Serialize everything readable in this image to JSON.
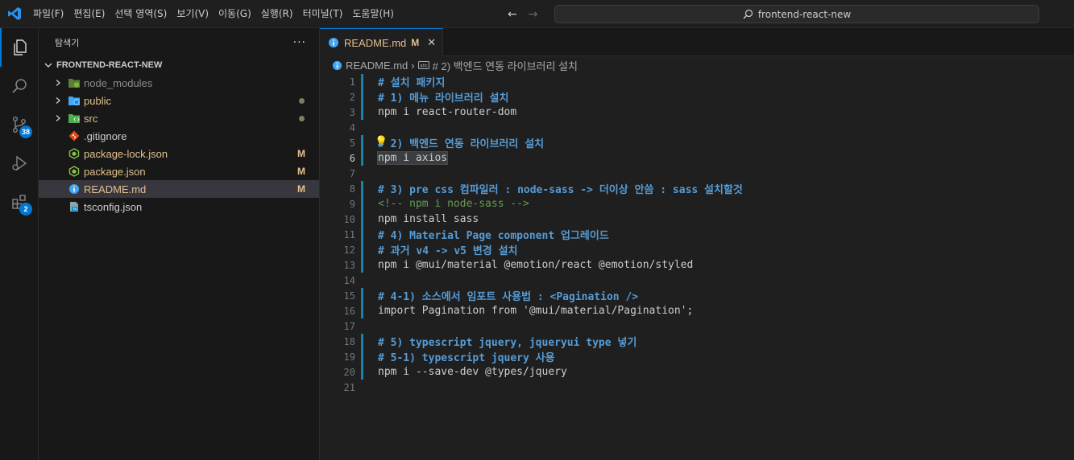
{
  "menu": [
    "파일(F)",
    "편집(E)",
    "선택 영역(S)",
    "보기(V)",
    "이동(G)",
    "실행(R)",
    "터미널(T)",
    "도움말(H)"
  ],
  "command_center": {
    "text": "frontend-react-new"
  },
  "activity": {
    "scm_badge": "38",
    "extensions_badge": "2"
  },
  "sidebar": {
    "title": "탐색기",
    "more": "···",
    "folder": "FRONTEND-REACT-NEW",
    "items": [
      {
        "name": "node_modules",
        "decoration": ""
      },
      {
        "name": "public",
        "decoration": ""
      },
      {
        "name": "src",
        "decoration": ""
      },
      {
        "name": ".gitignore",
        "decoration": ""
      },
      {
        "name": "package-lock.json",
        "decoration": "M"
      },
      {
        "name": "package.json",
        "decoration": "M"
      },
      {
        "name": "README.md",
        "decoration": "M"
      },
      {
        "name": "tsconfig.json",
        "decoration": ""
      }
    ]
  },
  "colors": {
    "accent": "#0078d4",
    "modified": "#e2c08d",
    "heading": "#569cd6",
    "comment": "#6a9955",
    "folder_public": "#519aba",
    "folder_src": "#4caf50"
  },
  "editor": {
    "tab": {
      "label": "README.md",
      "status": "M",
      "close": "✕"
    },
    "breadcrumb": {
      "file": "README.md",
      "symbol": "# 2) 백엔드 연동 라이브러리 설치"
    },
    "active_line": "6",
    "lines": [
      {
        "n": "1",
        "text": "# 설치 패키지"
      },
      {
        "n": "2",
        "text": "# 1) 메뉴 라이브러리 설치"
      },
      {
        "n": "3",
        "text": "npm i react-router-dom"
      },
      {
        "n": "4",
        "text": ""
      },
      {
        "n": "5",
        "text": "# 2) 백엔드 연동 라이브러리 설치"
      },
      {
        "n": "6",
        "text": "npm i axios"
      },
      {
        "n": "7",
        "text": ""
      },
      {
        "n": "8",
        "text": "# 3) pre css 컴파일러 : node-sass -> 더이상 안씀 : sass 설치할것"
      },
      {
        "n": "9",
        "text": "<!-- npm i node-sass -->"
      },
      {
        "n": "10",
        "text": "npm install sass"
      },
      {
        "n": "11",
        "text": "# 4) Material Page component 업그레이드"
      },
      {
        "n": "12",
        "text": "# 과거 v4 -> v5 변경 설치"
      },
      {
        "n": "13",
        "text": "npm i @mui/material @emotion/react @emotion/styled"
      },
      {
        "n": "14",
        "text": ""
      },
      {
        "n": "15",
        "text": "# 4-1) 소스에서 임포트 사용법 : <Pagination />"
      },
      {
        "n": "16",
        "text": "import Pagination from '@mui/material/Pagination';"
      },
      {
        "n": "17",
        "text": ""
      },
      {
        "n": "18",
        "text": "# 5) typescript jquery, jqueryui type 넣기"
      },
      {
        "n": "19",
        "text": "# 5-1) typescript jquery 사용"
      },
      {
        "n": "20",
        "text": "npm i --save-dev @types/jquery"
      },
      {
        "n": "21",
        "text": ""
      }
    ]
  }
}
